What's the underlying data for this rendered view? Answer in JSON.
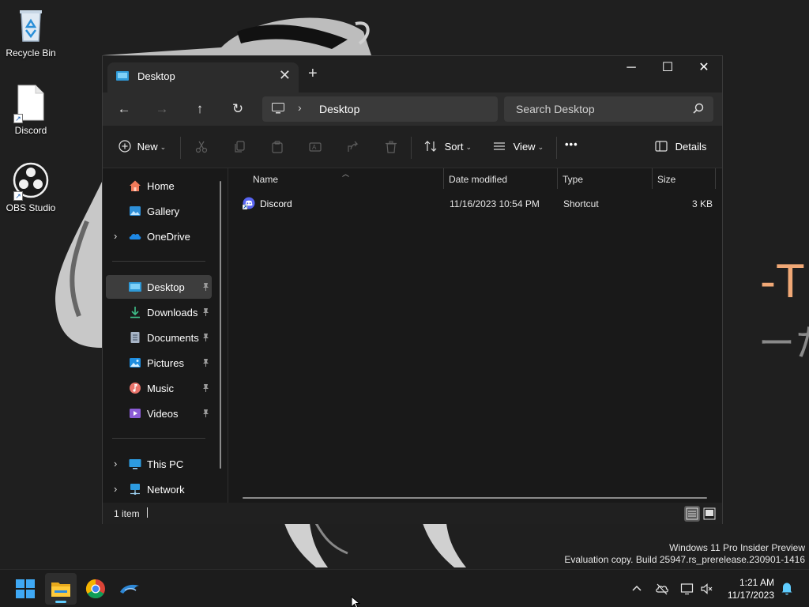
{
  "desktop": {
    "icons": [
      {
        "label": "Recycle Bin",
        "icon": "recycle-bin-icon"
      },
      {
        "label": "Discord",
        "icon": "file-shortcut-icon"
      },
      {
        "label": "OBS Studio",
        "icon": "obs-studio-icon"
      }
    ],
    "watermark": {
      "line1": "Windows 11 Pro Insider Preview",
      "line2": "Evaluation copy. Build 25947.rs_prerelease.230901-1416"
    }
  },
  "window": {
    "tab_title": "Desktop",
    "tab_icon": "desktop-folder-icon",
    "controls": {
      "minimize": "─",
      "maximize": "☐",
      "close": "✕"
    },
    "new_tab": "+",
    "nav": {
      "back": "←",
      "forward": "→",
      "up": "↑",
      "refresh": "↻"
    },
    "address": {
      "root_icon": "this-pc-icon",
      "separator": "›",
      "crumb": "Desktop"
    },
    "search": {
      "placeholder": "Search Desktop"
    },
    "commands": {
      "new_label": "New",
      "sort_label": "Sort",
      "view_label": "View",
      "more_label": "•••",
      "details_label": "Details",
      "disabled_icons": [
        "cut-icon",
        "copy-icon",
        "paste-icon",
        "rename-icon",
        "share-icon",
        "delete-icon"
      ]
    },
    "sidebar": {
      "items": [
        {
          "label": "Home",
          "icon": "home-icon",
          "expandable": false,
          "pinned": false
        },
        {
          "label": "Gallery",
          "icon": "gallery-icon",
          "expandable": false,
          "pinned": false
        },
        {
          "label": "OneDrive",
          "icon": "onedrive-cloud-icon",
          "expandable": true,
          "pinned": false
        },
        {
          "label": "Desktop",
          "icon": "desktop-folder-icon",
          "expandable": false,
          "pinned": true,
          "selected": true
        },
        {
          "label": "Downloads",
          "icon": "downloads-icon",
          "expandable": false,
          "pinned": true
        },
        {
          "label": "Documents",
          "icon": "documents-icon",
          "expandable": false,
          "pinned": true
        },
        {
          "label": "Pictures",
          "icon": "pictures-icon",
          "expandable": false,
          "pinned": true
        },
        {
          "label": "Music",
          "icon": "music-icon",
          "expandable": false,
          "pinned": true
        },
        {
          "label": "Videos",
          "icon": "videos-icon",
          "expandable": false,
          "pinned": true
        },
        {
          "label": "This PC",
          "icon": "this-pc-icon",
          "expandable": true,
          "pinned": false
        },
        {
          "label": "Network",
          "icon": "network-icon",
          "expandable": true,
          "pinned": false
        }
      ]
    },
    "columns": [
      "Name",
      "Date modified",
      "Type",
      "Size"
    ],
    "files": [
      {
        "name": "Discord",
        "date_modified": "11/16/2023 10:54 PM",
        "type": "Shortcut",
        "size": "3 KB",
        "icon": "discord-shortcut-icon"
      }
    ],
    "status": {
      "item_count": "1 item"
    }
  },
  "taskbar": {
    "apps": [
      {
        "name": "Start",
        "icon": "windows-start-icon"
      },
      {
        "name": "File Explorer",
        "icon": "file-explorer-icon",
        "active": true
      },
      {
        "name": "Google Chrome",
        "icon": "chrome-icon"
      },
      {
        "name": "Dolphin",
        "icon": "dolphin-icon"
      }
    ],
    "tray": [
      "chevron-up-icon",
      "onedrive-offline-icon",
      "network-display-icon",
      "volume-muted-icon"
    ],
    "time": "1:21 AM",
    "date": "11/17/2023"
  },
  "colors": {
    "accent": "#60cdff",
    "window_bg": "#191919",
    "titlebar_bg": "#202020",
    "taskbar_bg": "#1c1c1c"
  }
}
